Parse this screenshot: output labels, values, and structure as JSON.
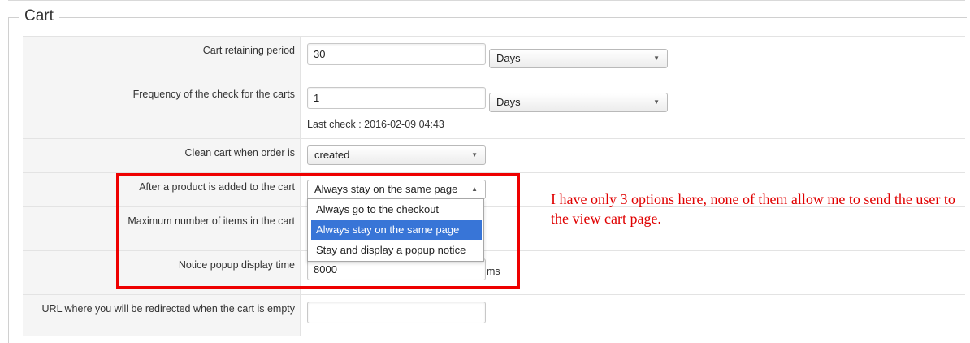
{
  "section": {
    "title": "Cart"
  },
  "fields": {
    "retaining_period": {
      "label": "Cart retaining period",
      "value": "30",
      "unit": "Days"
    },
    "check_frequency": {
      "label": "Frequency of the check for the carts",
      "value": "1",
      "unit": "Days",
      "last_check": "Last check : 2016-02-09 04:43"
    },
    "clean_cart": {
      "label": "Clean cart when order is",
      "value": "created"
    },
    "after_add": {
      "label": "After a product is added to the cart",
      "value": "Always stay on the same page",
      "options": [
        "Always go to the checkout",
        "Always stay on the same page",
        "Stay and display a popup notice"
      ],
      "selected_index": 1
    },
    "max_items": {
      "label": "Maximum number of items in the cart"
    },
    "notice_popup_time": {
      "label": "Notice popup display time",
      "value": "8000",
      "unit": "ms"
    },
    "empty_redirect_url": {
      "label": "URL where you will be redirected when the cart is empty",
      "value": ""
    }
  },
  "annotation": {
    "text": "I have only 3 options here, none of them allow me to send the user to the view cart page.",
    "color": "#e00000"
  },
  "colors": {
    "highlight_border": "#ee0000",
    "selected_option_bg": "#3875d7"
  },
  "icons": {
    "select_arrow": "▼",
    "select_arrow_up": "▲"
  }
}
